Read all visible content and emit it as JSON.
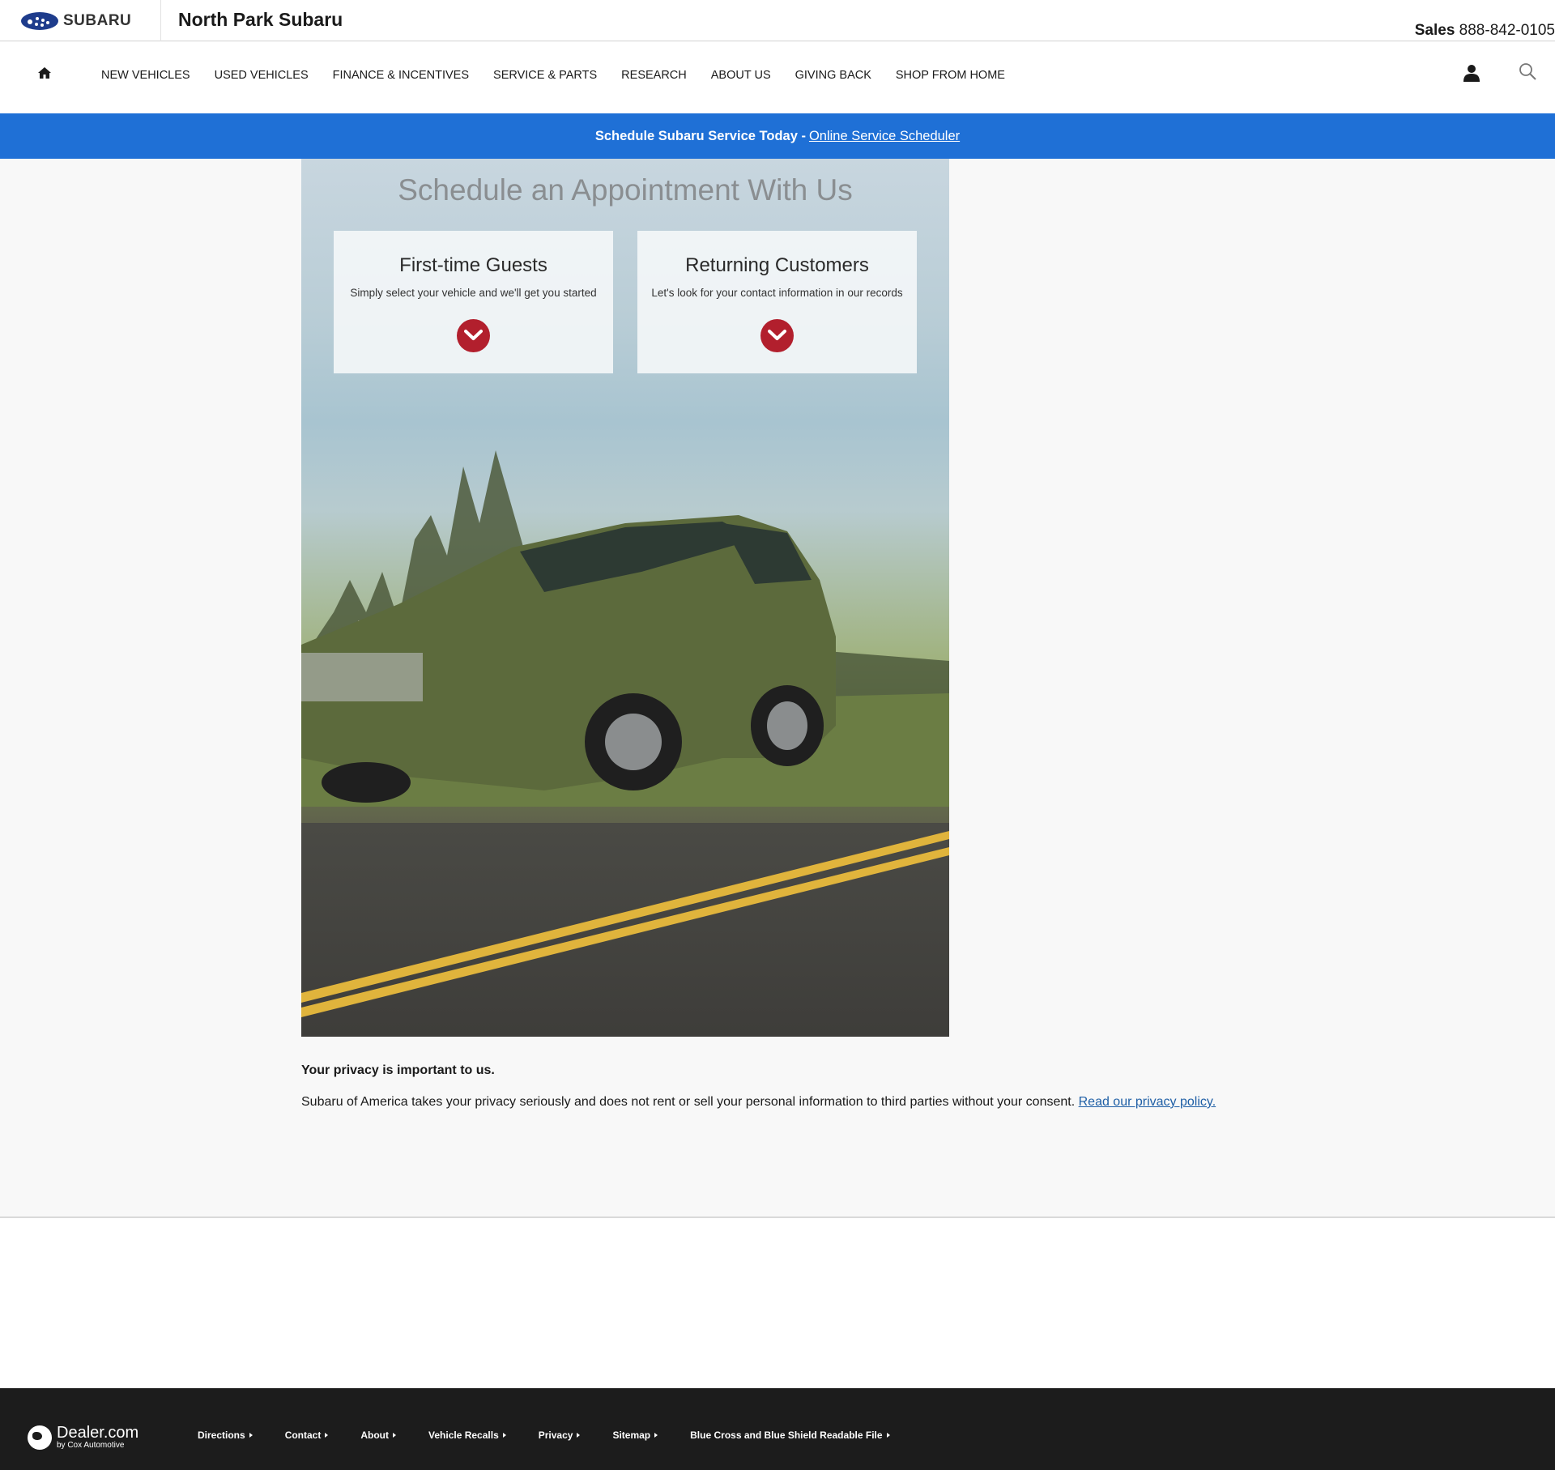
{
  "header": {
    "logo_text": "SUBARU",
    "dealer_name": "North Park Subaru",
    "sales_label": "Sales",
    "sales_phone": "888-842-0105"
  },
  "nav": {
    "items": [
      "NEW VEHICLES",
      "USED VEHICLES",
      "FINANCE & INCENTIVES",
      "SERVICE & PARTS",
      "RESEARCH",
      "ABOUT US",
      "GIVING BACK",
      "SHOP FROM HOME"
    ],
    "icons": [
      "home-icon",
      "user-icon",
      "search-icon"
    ]
  },
  "banner": {
    "text": "Schedule Subaru Service Today -",
    "link": "Online Service Scheduler",
    "color": "#1f70d6"
  },
  "hero": {
    "title": "Schedule an Appointment With Us",
    "cards": [
      {
        "title": "First-time Guests",
        "text": "Simply select your vehicle and we'll get you started"
      },
      {
        "title": "Returning Customers",
        "text": "Let's look for your contact information in our records"
      }
    ],
    "accent": "#b21f2d"
  },
  "privacy": {
    "title": "Your privacy is important to us.",
    "text": "Subaru of America takes your privacy seriously and does not rent or sell your personal information to third parties without your consent.",
    "link": "Read our privacy policy."
  },
  "footer": {
    "brand": "Dealer.com",
    "brand_sub": "by Cox Automotive",
    "links": [
      "Directions",
      "Contact",
      "About",
      "Vehicle Recalls",
      "Privacy",
      "Sitemap",
      "Blue Cross and Blue Shield Readable File"
    ]
  }
}
